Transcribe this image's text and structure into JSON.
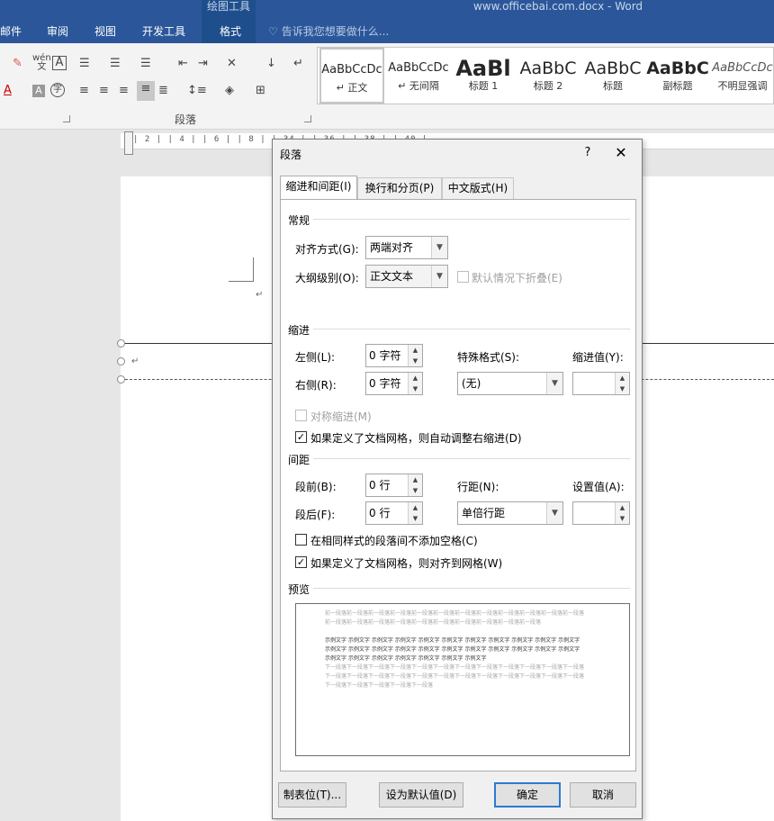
{
  "titlebar": {
    "context_tab": "绘图工具",
    "doc_title": "www.officebai.com.docx - Word",
    "tabs": [
      "邮件",
      "审阅",
      "视图",
      "开发工具"
    ],
    "format_tab": "格式",
    "tell_me": "告诉我您想要做什么..."
  },
  "ribbon": {
    "paragraph_group": "段落",
    "styles": [
      {
        "sample": "AaBbCcDc",
        "name": "↵ 正文"
      },
      {
        "sample": "AaBbCcDc",
        "name": "↵ 无间隔"
      },
      {
        "sample": "AaBl",
        "name": "标题 1"
      },
      {
        "sample": "AaBbC",
        "name": "标题 2"
      },
      {
        "sample": "AaBbC",
        "name": "标题"
      },
      {
        "sample": "AaBbC",
        "name": "副标题"
      },
      {
        "sample": "AaBbCcDc",
        "name": "不明显强调"
      }
    ]
  },
  "ruler": {
    "marks": "| 2 | | 4 | | 6 | | 8 |                                                     | 34 | | 36 | | 38 | | 40 |"
  },
  "document": {
    "para_mark": "↵"
  },
  "dialog": {
    "title": "段落",
    "help": "?",
    "close": "✕",
    "tabs": [
      "缩进和间距(I)",
      "换行和分页(P)",
      "中文版式(H)"
    ],
    "general": {
      "header": "常规",
      "alignment_label": "对齐方式(G):",
      "alignment_value": "两端对齐",
      "outline_label": "大纲级别(O):",
      "outline_value": "正文文本",
      "collapse_label": "默认情况下折叠(E)"
    },
    "indent": {
      "header": "缩进",
      "left_label": "左侧(L):",
      "left_value": "0 字符",
      "right_label": "右侧(R):",
      "right_value": "0 字符",
      "special_label": "特殊格式(S):",
      "special_value": "(无)",
      "by_label": "缩进值(Y):",
      "by_value": "",
      "mirror_label": "对称缩进(M)",
      "auto_adjust_label": "如果定义了文档网格，则自动调整右缩进(D)"
    },
    "spacing": {
      "header": "间距",
      "before_label": "段前(B):",
      "before_value": "0 行",
      "after_label": "段后(F):",
      "after_value": "0 行",
      "line_label": "行距(N):",
      "line_value": "单倍行距",
      "at_label": "设置值(A):",
      "at_value": "",
      "no_space_label": "在相同样式的段落间不添加空格(C)",
      "snap_grid_label": "如果定义了文档网格，则对齐到网格(W)"
    },
    "preview": {
      "header": "预览",
      "prev_text": "前一段落前一段落前一段落前一段落前一段落前一段落前一段落前一段落前一段落前一段落前一段落前一段落前一段落前一段落前一段落前一段落前一段落前一段落前一段落前一段落前一段落前一段落",
      "sample_text": "示例文字 示例文字 示例文字 示例文字 示例文字 示例文字 示例文字 示例文字 示例文字 示例文字 示例文字 示例文字 示例文字 示例文字 示例文字 示例文字 示例文字 示例文字 示例文字 示例文字 示例文字 示例文字 示例文字 示例文字 示例文字 示例文字 示例文字 示例文字 示例文字",
      "next_text": "下一段落下一段落下一段落下一段落下一段落下一段落下一段落下一段落下一段落下一段落下一段落下一段落下一段落下一段落下一段落下一段落下一段落下一段落下一段落下一段落下一段落下一段落下一段落下一段落下一段落下一段落下一段落下一段落下一段落"
    },
    "buttons": {
      "tabs": "制表位(T)...",
      "default": "设为默认值(D)",
      "ok": "确定",
      "cancel": "取消"
    }
  }
}
